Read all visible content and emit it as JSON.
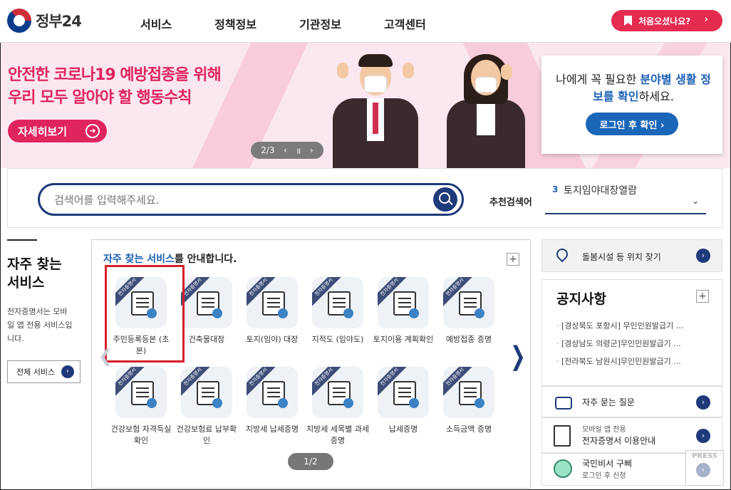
{
  "header": {
    "logo_text": "정부24",
    "nav": [
      "서비스",
      "정책정보",
      "기관정보",
      "고객센터"
    ],
    "first_visit_label": "처음오셨나요?",
    "first_visit_arrow": "›"
  },
  "banner": {
    "title_line1": "안전한 코로나19 예방접종을 위해",
    "title_line2": "우리 모두 알아야 할 행동수칙",
    "detail_label": "자세히보기",
    "pager_text": "2/3",
    "pager_prev": "‹",
    "pager_pause": "॥",
    "pager_next": "›"
  },
  "login_card": {
    "text_part1": "나에게 꼭 필요한 ",
    "text_highlight1": "분야별 생활 정보를 확인",
    "text_part2": "하세요.",
    "button_label": "로그인 후 확인 ›"
  },
  "search": {
    "placeholder": "검색어를 입력해주세요.",
    "recommend_label": "추천검색어",
    "recommend_rank": "3",
    "recommend_value": "토지임야대장열람",
    "recommend_chevron": "⌄"
  },
  "left_panel": {
    "title": "자주 찾는 서비스",
    "desc": "전자증명서는 모바일 앱 전용 서비스입니다.",
    "all_services_label": "전체 서비스",
    "all_services_arrow": "›"
  },
  "services": {
    "heading_highlight": "자주 찾는 서비스",
    "heading_rest": "를 안내합니다.",
    "plus": "+",
    "ribbon": "전자증명서",
    "items": [
      {
        "label": "주민등록등본 (초본)",
        "icon": "id-card-icon"
      },
      {
        "label": "건축물대장",
        "icon": "building-doc-icon"
      },
      {
        "label": "토지(임야) 대장",
        "icon": "land-map-icon"
      },
      {
        "label": "지적도 (임야도)",
        "icon": "cadastral-map-icon"
      },
      {
        "label": "토지이용 계획확인",
        "icon": "land-plan-icon"
      },
      {
        "label": "예방접종 증명",
        "icon": "vaccine-icon"
      },
      {
        "label": "건강보험 자격득실확인",
        "icon": "checklist-icon"
      },
      {
        "label": "건강보험료 납부확인",
        "icon": "clipboard-check-icon"
      },
      {
        "label": "지방세 납세증명",
        "icon": "tax-doc-icon"
      },
      {
        "label": "지방세 세목별 과세증명",
        "icon": "chart-board-icon"
      },
      {
        "label": "납세증명",
        "icon": "coins-doc-icon"
      },
      {
        "label": "소득금액 증명",
        "icon": "income-doc-icon"
      }
    ],
    "pager_text": "1/2",
    "next_arrow": "❯",
    "prev_arrow": "❮"
  },
  "right_panel": {
    "location_text": "돌봄시설 등 위치 찾기",
    "arrow": "›",
    "notice_title": "공지사항",
    "notice_plus": "+",
    "notices": [
      "[경상북도 포항시] 무인민원발급기 ...",
      "[경상남도 의령군]무인민원발급기 ...",
      "[전라북도 남원시]무인민원발급기 ..."
    ],
    "faq_label": "자주 묻는 질문",
    "mobile_small": "모바일 앱 전용",
    "mobile_label": "전자증명서 이용안내",
    "robot_label": "국민비서 구삐",
    "robot_small": "로그인 후 신청"
  },
  "watermark": "PRESS"
}
